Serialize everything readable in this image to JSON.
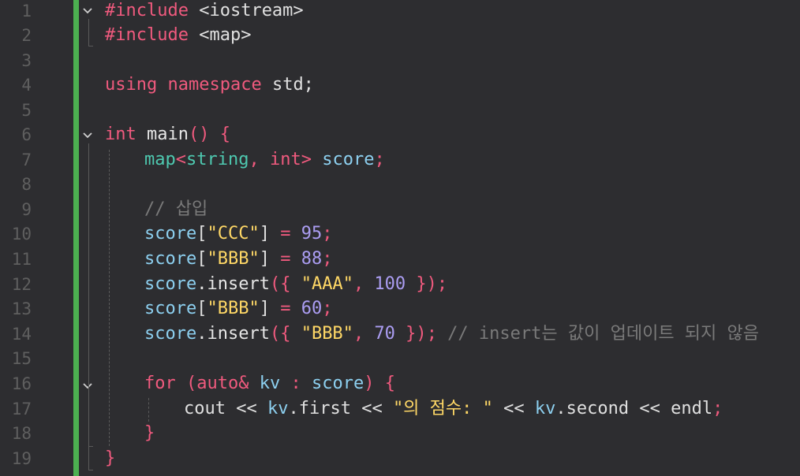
{
  "editor": {
    "line_numbers": [
      "1",
      "2",
      "3",
      "4",
      "5",
      "6",
      "7",
      "8",
      "9",
      "10",
      "11",
      "12",
      "13",
      "14",
      "15",
      "16",
      "17",
      "18",
      "19"
    ],
    "lines": {
      "l1": {
        "a": "#include",
        "b": " ",
        "c": "<iostream>"
      },
      "l2": {
        "a": "#include",
        "b": " ",
        "c": "<map>"
      },
      "l4": {
        "a": "using",
        "b": " ",
        "c": "namespace",
        "d": " std;"
      },
      "l6": {
        "a": "int",
        "b": " main",
        "c": "()",
        "d": " {"
      },
      "l7": {
        "a": "map",
        "b": "<",
        "c": "string",
        "d": ",",
        "e": " int",
        "f": ">",
        "g": " score",
        "h": ";"
      },
      "l9": {
        "a": "// 삽입"
      },
      "l10": {
        "a": "score",
        "b": "[",
        "c": "\"CCC\"",
        "d": "]",
        "e": " = ",
        "f": "95",
        "g": ";"
      },
      "l11": {
        "a": "score",
        "b": "[",
        "c": "\"BBB\"",
        "d": "]",
        "e": " = ",
        "f": "88",
        "g": ";"
      },
      "l12": {
        "a": "score",
        "b": ".insert",
        "c": "({",
        "d": " \"AAA\"",
        "e": ",",
        "f": " 100",
        "g": " })",
        "h": ";"
      },
      "l13": {
        "a": "score",
        "b": "[",
        "c": "\"BBB\"",
        "d": "]",
        "e": " = ",
        "f": "60",
        "g": ";"
      },
      "l14": {
        "a": "score",
        "b": ".insert",
        "c": "({",
        "d": " \"BBB\"",
        "e": ",",
        "f": " 70",
        "g": " })",
        "h": ";",
        "i": " // insert는 값이 업데이트 되지 않음"
      },
      "l16": {
        "a": "for",
        "b": " (",
        "c": "auto&",
        "d": " kv",
        "e": " :",
        "f": " score",
        "g": ")",
        "h": " {"
      },
      "l17": {
        "a": "cout",
        "b": " << ",
        "c": "kv",
        "d": ".first",
        "e": " << ",
        "f": "\"의 점수: \"",
        "g": " << ",
        "h": "kv",
        "i": ".second",
        "j": " << ",
        "k": "endl",
        "l": ";"
      },
      "l18": {
        "a": "}"
      },
      "l19": {
        "a": "}"
      }
    }
  },
  "colors": {
    "background": "#2d2d30",
    "change_bar": "#4caf50",
    "keyword": "#f05a7e",
    "type": "#4ec9b0",
    "variable": "#8dd0f0",
    "string": "#ffd866",
    "number": "#ab9df2",
    "comment": "#7a7a7a",
    "line_number": "#5f5f5f"
  },
  "icons": {
    "fold": "chevron-down-icon"
  }
}
